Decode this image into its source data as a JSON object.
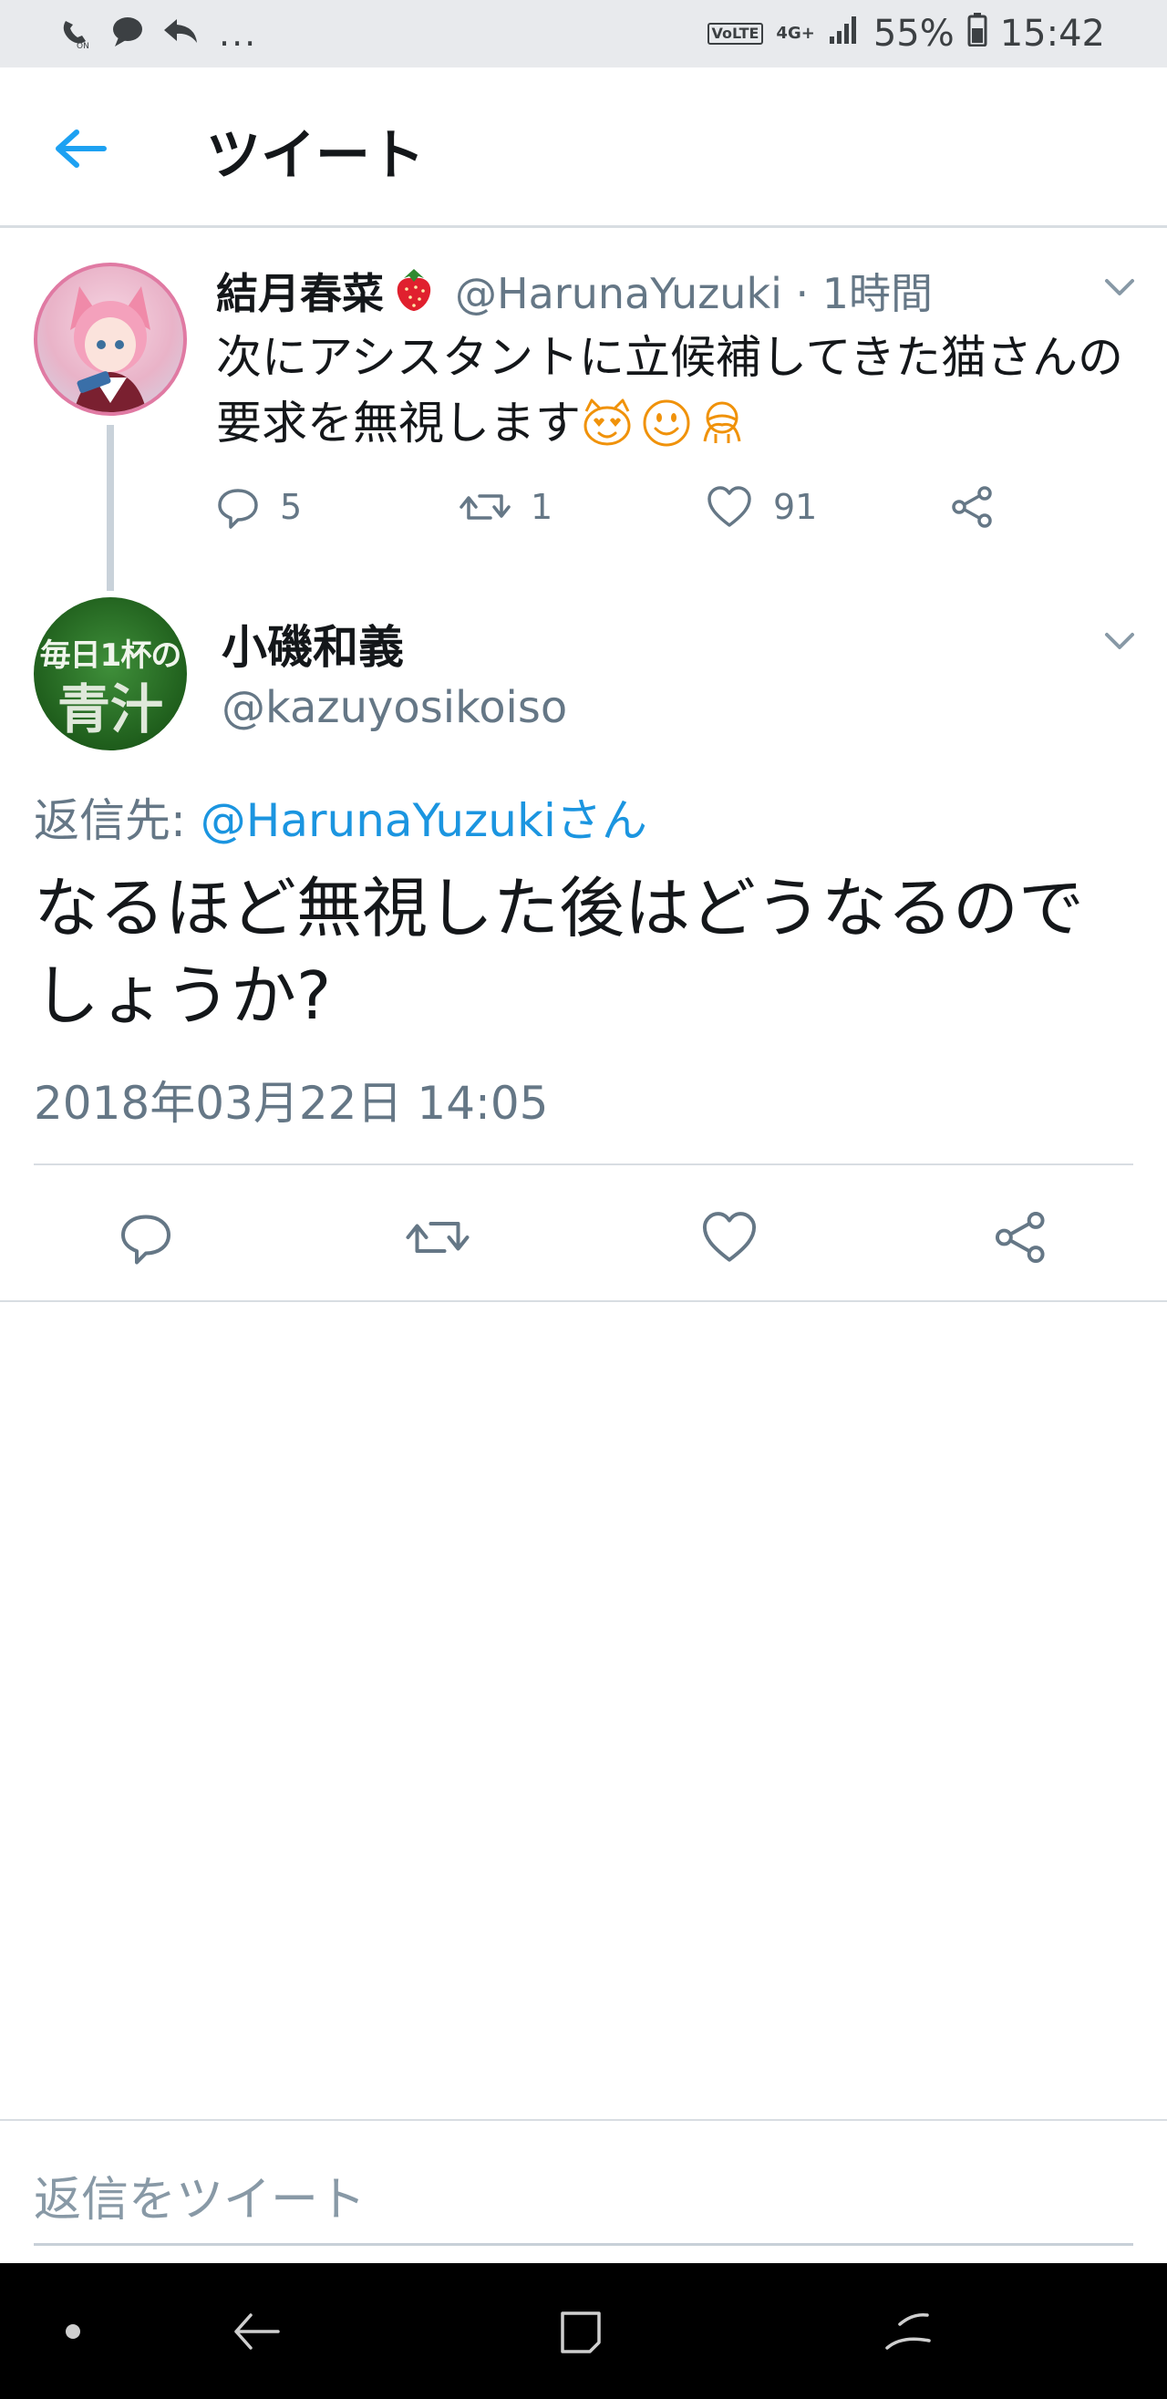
{
  "status_bar": {
    "left_icons": [
      "wifi-calling-icon",
      "message-icon",
      "reply-icon"
    ],
    "more": "...",
    "volte": "VoLTE",
    "network": "4G+",
    "battery": "55%",
    "time": "15:42"
  },
  "header": {
    "back_icon": "arrow-left-icon",
    "title": "ツイート"
  },
  "tweet1": {
    "name": "結月春菜",
    "handle_time": "@HarunaYuzuki · 1時間",
    "text": "次にアシスタントに立候補してきた猫さんの要求を無視します",
    "emojis": [
      "heart-eyes-cat-icon",
      "smiley-icon",
      "see-no-evil-icon"
    ],
    "replies": "5",
    "retweets": "1",
    "likes": "91"
  },
  "tweet2": {
    "name": "小磯和義",
    "handle": "@kazuyosikoiso",
    "avatar_line1": "毎日1杯の",
    "avatar_line2": "青汁",
    "reply_prefix": "返信先: ",
    "reply_mention": "@HarunaYuzukiさん",
    "text": "なるほど無視した後はどうなるのでしょうか?",
    "timestamp": "2018年03月22日 14:05"
  },
  "composer": {
    "placeholder": "返信をツイート"
  },
  "colors": {
    "accent": "#1b95e0",
    "secondary_text": "#657786",
    "divider": "#d8dde2",
    "status_bar_bg": "#e8eaed"
  }
}
